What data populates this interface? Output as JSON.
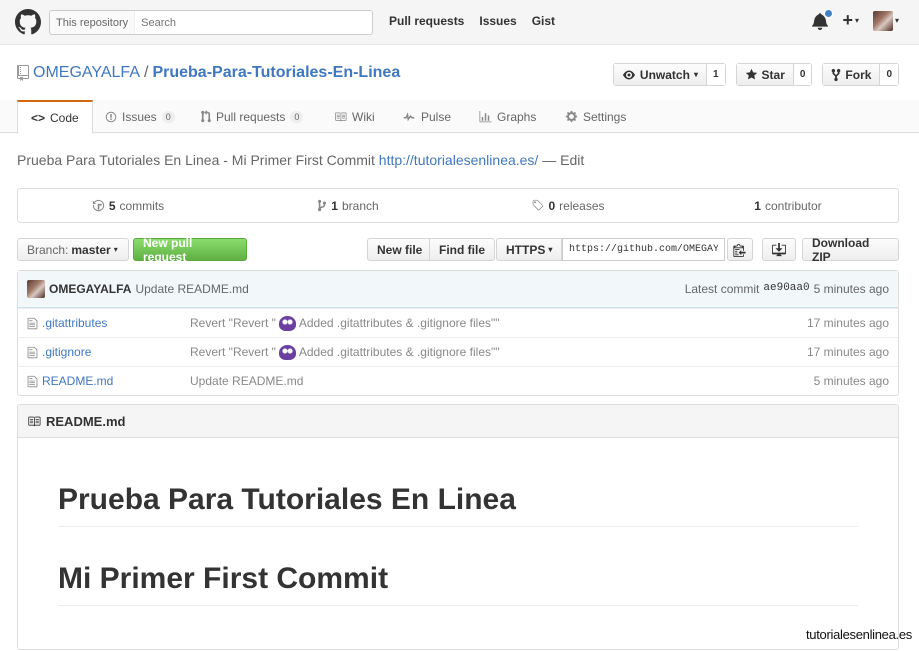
{
  "header": {
    "search_scope": "This repository",
    "search_placeholder": "Search",
    "nav": [
      "Pull requests",
      "Issues",
      "Gist"
    ]
  },
  "repo": {
    "owner": "OMEGAYALFA",
    "separator": "/",
    "name": "Prueba-Para-Tutoriales-En-Linea",
    "watch": {
      "label": "Unwatch",
      "count": "1"
    },
    "star": {
      "label": "Star",
      "count": "0"
    },
    "fork": {
      "label": "Fork",
      "count": "0"
    }
  },
  "tabs": {
    "code": "Code",
    "issues": {
      "label": "Issues",
      "count": "0"
    },
    "pulls": {
      "label": "Pull requests",
      "count": "0"
    },
    "wiki": "Wiki",
    "pulse": "Pulse",
    "graphs": "Graphs",
    "settings": "Settings"
  },
  "description": {
    "text": "Prueba Para Tutoriales En Linea - Mi Primer First Commit",
    "url": "http://tutorialesenlinea.es/",
    "edit": "— Edit"
  },
  "summary": {
    "commits": {
      "num": "5",
      "label": "commits"
    },
    "branches": {
      "num": "1",
      "label": "branch"
    },
    "releases": {
      "num": "0",
      "label": "releases"
    },
    "contributors": {
      "num": "1",
      "label": "contributor"
    }
  },
  "filenav": {
    "branch_label": "Branch:",
    "branch": "master",
    "new_pr": "New pull request",
    "new_file": "New file",
    "find_file": "Find file",
    "protocol": "HTTPS",
    "clone_url": "https://github.com/OMEGAYALFA/Prueba-Para-Tutoriales-En-Linea.git",
    "download": "Download ZIP"
  },
  "commit_tease": {
    "author": "OMEGAYALFA",
    "message": "Update README.md",
    "latest_label": "Latest commit",
    "sha": "ae90aa0",
    "age": "5 minutes ago"
  },
  "files": [
    {
      "name": ".gitattributes",
      "msg_pre": "Revert \"Revert \"",
      "msg_post": "Added .gitattributes & .gitignore files\"\"",
      "has_emoji": true,
      "age": "17 minutes ago"
    },
    {
      "name": ".gitignore",
      "msg_pre": "Revert \"Revert \"",
      "msg_post": "Added .gitattributes & .gitignore files\"\"",
      "has_emoji": true,
      "age": "17 minutes ago"
    },
    {
      "name": "README.md",
      "msg_pre": "Update README.md",
      "msg_post": "",
      "has_emoji": false,
      "age": "5 minutes ago"
    }
  ],
  "readme": {
    "title": "README.md",
    "h1_first": "Prueba Para Tutoriales En Linea",
    "h1_second": "Mi Primer First Commit"
  },
  "watermark": "tutorialesenlinea.es",
  "colors": {
    "link": "#4078c0",
    "green_button": "#60b044",
    "tab_accent": "#d26911",
    "notification_dot": "#4183c4"
  }
}
